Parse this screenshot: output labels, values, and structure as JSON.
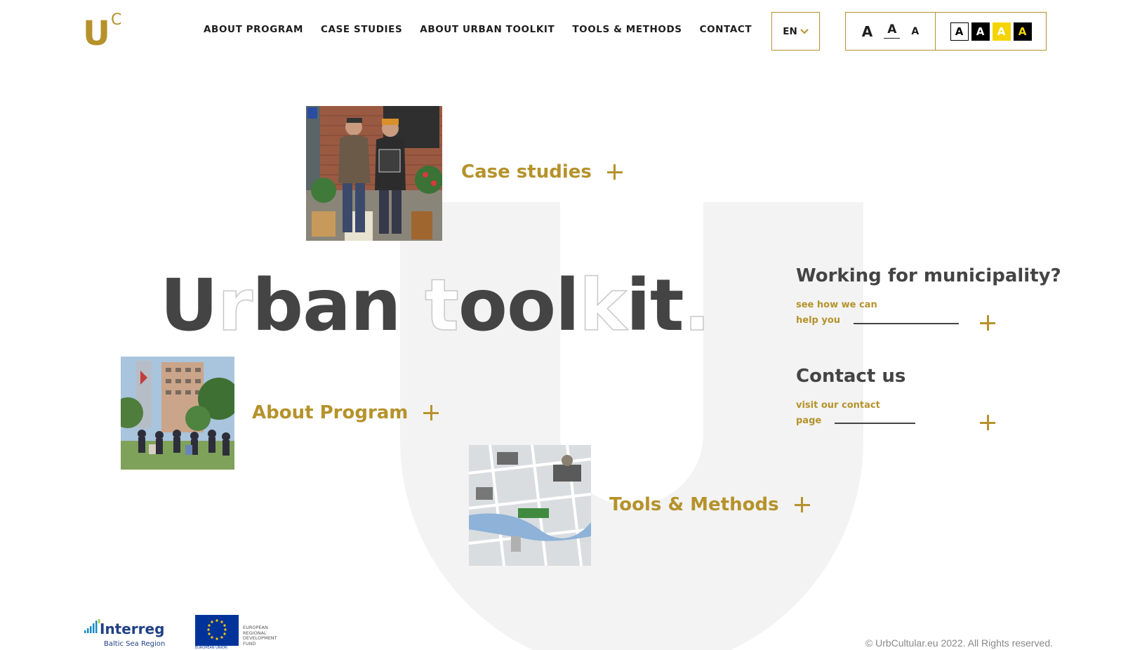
{
  "brand": {
    "logo_main": "U",
    "logo_sup": "C",
    "accent": "#b5922b",
    "text_dark": "#444444"
  },
  "nav": {
    "items": [
      {
        "label": "ABOUT PROGRAM"
      },
      {
        "label": "CASE STUDIES"
      },
      {
        "label": "ABOUT URBAN TOOLKIT"
      },
      {
        "label": "TOOLS & METHODS"
      },
      {
        "label": "CONTACT"
      }
    ]
  },
  "language": {
    "current": "EN"
  },
  "accessibility": {
    "text_sizes": [
      "A",
      "A",
      "A"
    ],
    "contrast_modes": [
      "A",
      "A",
      "A",
      "A"
    ]
  },
  "hero": {
    "title_parts": [
      {
        "text": "U",
        "style": "solid"
      },
      {
        "text": "r",
        "style": "outline"
      },
      {
        "text": "ban ",
        "style": "solid"
      },
      {
        "text": "t",
        "style": "outline"
      },
      {
        "text": "ool",
        "style": "solid"
      },
      {
        "text": "k",
        "style": "outline"
      },
      {
        "text": "it",
        "style": "solid"
      },
      {
        "text": ".",
        "style": "outline"
      }
    ]
  },
  "tiles": {
    "case_studies": "Case studies",
    "about_program": "About Program",
    "tools_methods": "Tools & Methods"
  },
  "cta": {
    "municipality": {
      "title": "Working for municipality?",
      "sub": "see how we can help you"
    },
    "contact": {
      "title": "Contact us",
      "sub": "visit our contact page"
    }
  },
  "footer": {
    "interreg_name": "Interreg",
    "interreg_region": "Baltic Sea Region",
    "eu_label": "EUROPEAN UNION",
    "eu_fund": "EUROPEAN REGIONAL DEVELOPMENT FUND",
    "copyright": "© UrbCultular.eu 2022. All Rights reserved."
  }
}
